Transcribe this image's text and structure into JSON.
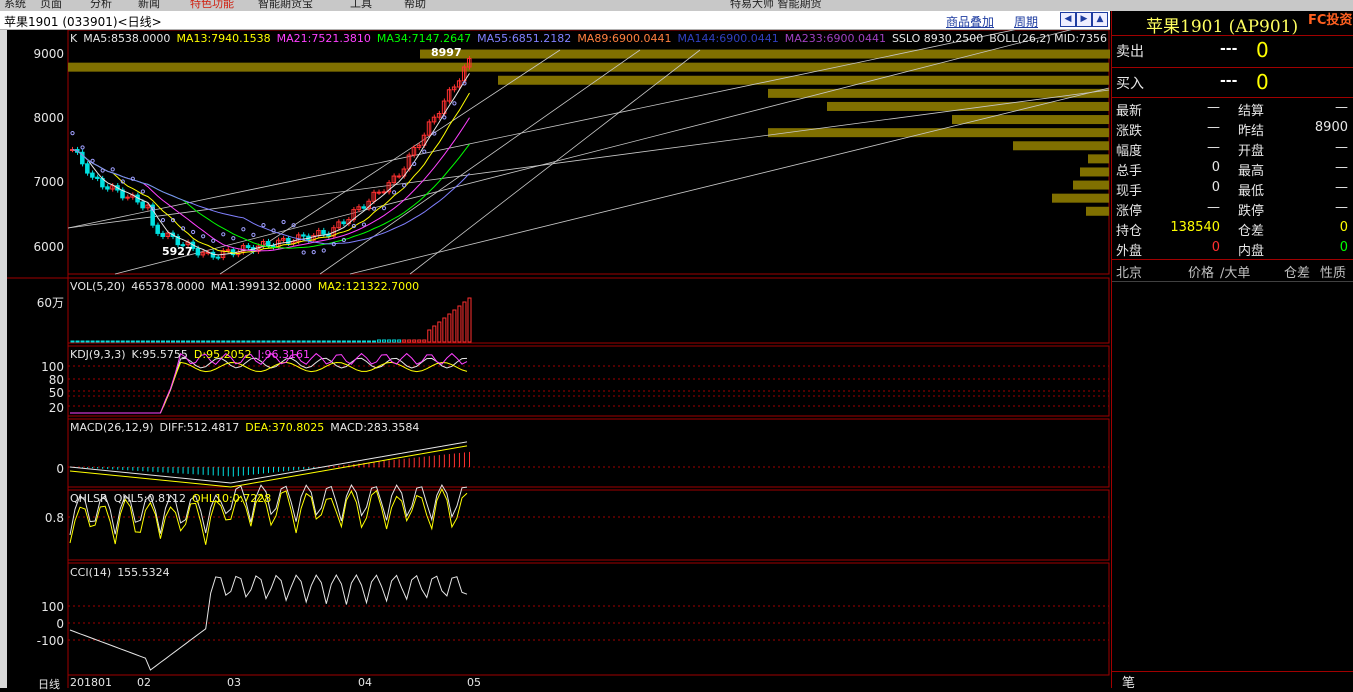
{
  "top_menu": {
    "items": [
      "系统",
      "页面",
      "分析",
      "新闻",
      "特色功能",
      "智能期货宝",
      "工具",
      "帮助"
    ],
    "promo": "特易大师 智能期货"
  },
  "toolbar": {
    "symbol_title": "苹果1901 (033901)<日线>",
    "overlay_link": "商品叠加",
    "period_link": "周期",
    "nav_buttons": [
      "◀",
      "▶",
      "▲",
      "▼"
    ]
  },
  "main_chart": {
    "indicator_line": [
      {
        "text": "K",
        "color": "#e6e6e6"
      },
      {
        "text": "MA5:8538.0000",
        "color": "#e6e6e6"
      },
      {
        "text": "MA13:7940.1538",
        "color": "#ffff00"
      },
      {
        "text": "MA21:7521.3810",
        "color": "#ff40ff"
      },
      {
        "text": "MA34:7147.2647",
        "color": "#00ff00"
      },
      {
        "text": "MA55:6851.2182",
        "color": "#8080ff"
      },
      {
        "text": "MA89:6900.0441",
        "color": "#ff8040"
      },
      {
        "text": "MA144:6900.0441",
        "color": "#3040c0"
      },
      {
        "text": "MA233:6900.0441",
        "color": "#a040c0"
      },
      {
        "text": "SSLO  8930.2500",
        "color": "#e6e6e6"
      },
      {
        "text": "BOLL(26,2)  MID:7356",
        "color": "#e6e6e6"
      }
    ],
    "y_ticks": [
      "9000",
      "8000",
      "7000",
      "6000"
    ],
    "high_label": "8997",
    "low_label": "5927"
  },
  "sub_panels": [
    {
      "title": "VOL(5,20)",
      "values": [
        {
          "t": "465378.0000",
          "c": "#e6e6e6"
        },
        {
          "t": "MA1:399132.0000",
          "c": "#e6e6e6"
        },
        {
          "t": "MA2:121322.7000",
          "c": "#ffff00"
        }
      ],
      "y_ticks": [
        "60万"
      ]
    },
    {
      "title": "KDJ(9,3,3)",
      "values": [
        {
          "t": "K:95.5755",
          "c": "#e6e6e6"
        },
        {
          "t": "D:95.2052",
          "c": "#ffff00"
        },
        {
          "t": "J:96.3161",
          "c": "#ff40ff"
        }
      ],
      "y_ticks": [
        "100",
        "80",
        "50",
        "20"
      ]
    },
    {
      "title": "MACD(26,12,9)",
      "values": [
        {
          "t": "DIFF:512.4817",
          "c": "#e6e6e6"
        },
        {
          "t": "DEA:370.8025",
          "c": "#ffff00"
        },
        {
          "t": "MACD:283.3584",
          "c": "#e6e6e6"
        }
      ],
      "y_ticks": [
        "0"
      ]
    },
    {
      "title": "QHLSR",
      "values": [
        {
          "t": "QHL5:0.8112",
          "c": "#e6e6e6"
        },
        {
          "t": "QHL10:0.7228",
          "c": "#ffff00"
        }
      ],
      "y_ticks": [
        "0.8"
      ]
    },
    {
      "title": "CCI(14)",
      "values": [
        {
          "t": "155.5324",
          "c": "#e6e6e6"
        }
      ],
      "y_ticks": [
        "100",
        "0",
        "-100"
      ]
    }
  ],
  "x_axis": {
    "period": "日线",
    "labels": [
      "201801",
      "02",
      "03",
      "04",
      "05"
    ]
  },
  "quote_panel": {
    "title": "苹果1901 (AP901)",
    "watermark": "FC投资",
    "ask": {
      "label": "卖出",
      "price": "---",
      "vol": "0"
    },
    "bid": {
      "label": "买入",
      "price": "---",
      "vol": "0"
    },
    "rows": [
      {
        "k": "最新",
        "v": "—",
        "k2": "结算",
        "v2": "—",
        "c": "#e6e6e6",
        "c2": "#e6e6e6"
      },
      {
        "k": "涨跌",
        "v": "—",
        "k2": "昨结",
        "v2": "8900",
        "c": "#e6e6e6",
        "c2": "#e6e6e6"
      },
      {
        "k": "幅度",
        "v": "—",
        "k2": "开盘",
        "v2": "—",
        "c": "#e6e6e6",
        "c2": "#e6e6e6"
      },
      {
        "k": "总手",
        "v": "0",
        "k2": "最高",
        "v2": "—",
        "c": "#e6e6e6",
        "c2": "#e6e6e6"
      },
      {
        "k": "现手",
        "v": "0",
        "k2": "最低",
        "v2": "—",
        "c": "#e6e6e6",
        "c2": "#e6e6e6"
      },
      {
        "k": "涨停",
        "v": "—",
        "k2": "跌停",
        "v2": "—",
        "c": "#e6e6e6",
        "c2": "#e6e6e6"
      },
      {
        "k": "持仓",
        "v": "138540",
        "k2": "仓差",
        "v2": "0",
        "c": "#ffff00",
        "c2": "#ffff00"
      },
      {
        "k": "外盘",
        "v": "0",
        "k2": "内盘",
        "v2": "0",
        "c": "#ff3030",
        "c2": "#00ff00"
      }
    ],
    "trade_header": {
      "location": "北京",
      "price": "价格",
      "vol": "∕大单",
      "oi": "仓差",
      "nature": "性质"
    },
    "bottom_tab": "笔"
  },
  "colors": {
    "up": "#ff3030",
    "down": "#00e0e0",
    "grid": "#a00000",
    "ma5": "#e6e6e6",
    "ma13": "#ffff00",
    "ma21": "#ff40ff",
    "ma34": "#00ff00",
    "ma55": "#8080ff",
    "sar": "#a0a0ff",
    "volume_profile": "#807000"
  }
}
